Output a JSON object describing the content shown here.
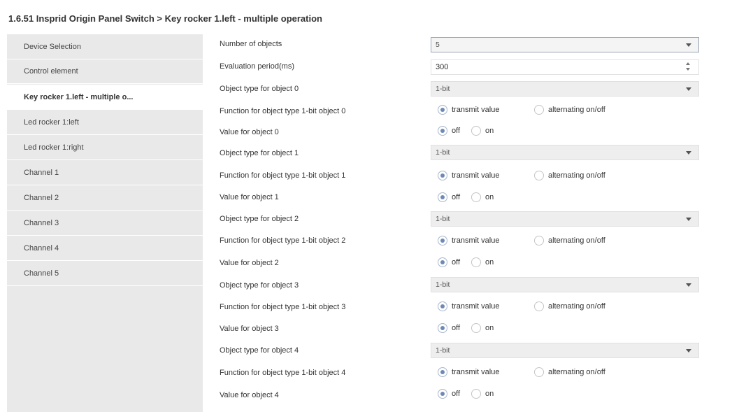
{
  "header": {
    "title": "1.6.51 Insprid Origin Panel Switch > Key rocker 1.left - multiple operation"
  },
  "sidebar": {
    "items": [
      {
        "label": "Device Selection"
      },
      {
        "label": "Control element"
      },
      {
        "label": "Key rocker 1.left - multiple o...",
        "active": true
      },
      {
        "label": "Led rocker 1:left"
      },
      {
        "label": "Led rocker 1:right"
      },
      {
        "label": "Channel 1"
      },
      {
        "label": "Channel 2"
      },
      {
        "label": "Channel 3"
      },
      {
        "label": "Channel 4"
      },
      {
        "label": "Channel 5"
      }
    ]
  },
  "params": {
    "num_objects": {
      "label": "Number of objects",
      "value": "5"
    },
    "eval_period": {
      "label": "Evaluation period(ms)",
      "value": "300"
    },
    "objects": [
      {
        "type_label": "Object type for object 0",
        "type_value": "1-bit",
        "func_label": "Function for object type 1-bit object 0",
        "func_opt1": "transmit value",
        "func_opt2": "alternating on/off",
        "value_label": "Value for object 0",
        "val_opt1": "off",
        "val_opt2": "on"
      },
      {
        "type_label": "Object type for object 1",
        "type_value": "1-bit",
        "func_label": "Function for object type 1-bit object 1",
        "func_opt1": "transmit value",
        "func_opt2": "alternating on/off",
        "value_label": "Value for object 1",
        "val_opt1": "off",
        "val_opt2": "on"
      },
      {
        "type_label": "Object type for object 2",
        "type_value": "1-bit",
        "func_label": "Function for object type 1-bit object 2",
        "func_opt1": "transmit value",
        "func_opt2": "alternating on/off",
        "value_label": "Value for object 2",
        "val_opt1": "off",
        "val_opt2": "on"
      },
      {
        "type_label": "Object type for object 3",
        "type_value": "1-bit",
        "func_label": "Function for object type 1-bit object 3",
        "func_opt1": "transmit value",
        "func_opt2": "alternating on/off",
        "value_label": "Value for object 3",
        "val_opt1": "off",
        "val_opt2": "on"
      },
      {
        "type_label": "Object type for object 4",
        "type_value": "1-bit",
        "func_label": "Function for object type 1-bit object 4",
        "func_opt1": "transmit value",
        "func_opt2": "alternating on/off",
        "value_label": "Value for object 4",
        "val_opt1": "off",
        "val_opt2": "on"
      }
    ]
  },
  "colors": {
    "sidebar_bg": "#e9e9e9",
    "radio_checked": "#6f89b6",
    "select_bg": "#eeeeee"
  }
}
